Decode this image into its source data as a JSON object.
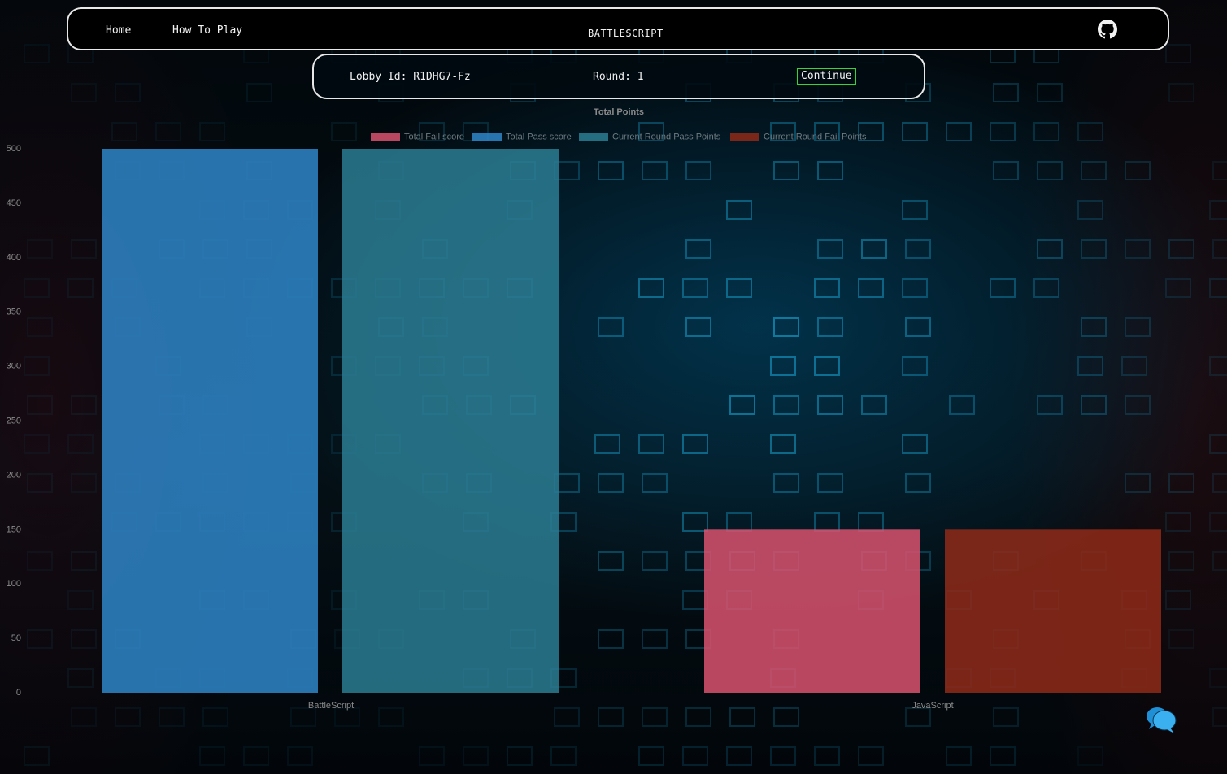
{
  "navbar": {
    "home_label": "Home",
    "how_to_play_label": "How To Play",
    "brand": "BATTLESCRIPT",
    "github_icon": "github-icon"
  },
  "lobby": {
    "lobby_id_text": "Lobby Id: R1DHG7-Fz",
    "round_text": "Round: 1",
    "continue_label": "Continue"
  },
  "chat": {
    "icon": "chat-bubbles-icon"
  },
  "colors": {
    "total_fail": "#d9526f",
    "total_pass": "#2f86c9",
    "current_pass": "#2b7d93",
    "current_fail": "#8f2a19",
    "continue_border": "#37d437"
  },
  "chart_data": {
    "type": "bar",
    "title": "Total Points",
    "categories": [
      "BattleScript",
      "JavaScript"
    ],
    "series": [
      {
        "name": "Total Fail score",
        "values": [
          0,
          150
        ],
        "color": "#d9526f"
      },
      {
        "name": "Total Pass score",
        "values": [
          500,
          0
        ],
        "color": "#2f86c9"
      },
      {
        "name": "Current Round Pass Points",
        "values": [
          500,
          0
        ],
        "color": "#2b7d93"
      },
      {
        "name": "Current Round Fail Points",
        "values": [
          0,
          150
        ],
        "color": "#8f2a19"
      }
    ],
    "ylim": [
      0,
      500
    ],
    "yticks": [
      0,
      50,
      100,
      150,
      200,
      250,
      300,
      350,
      400,
      450,
      500
    ],
    "grid": false,
    "legend": "top"
  }
}
